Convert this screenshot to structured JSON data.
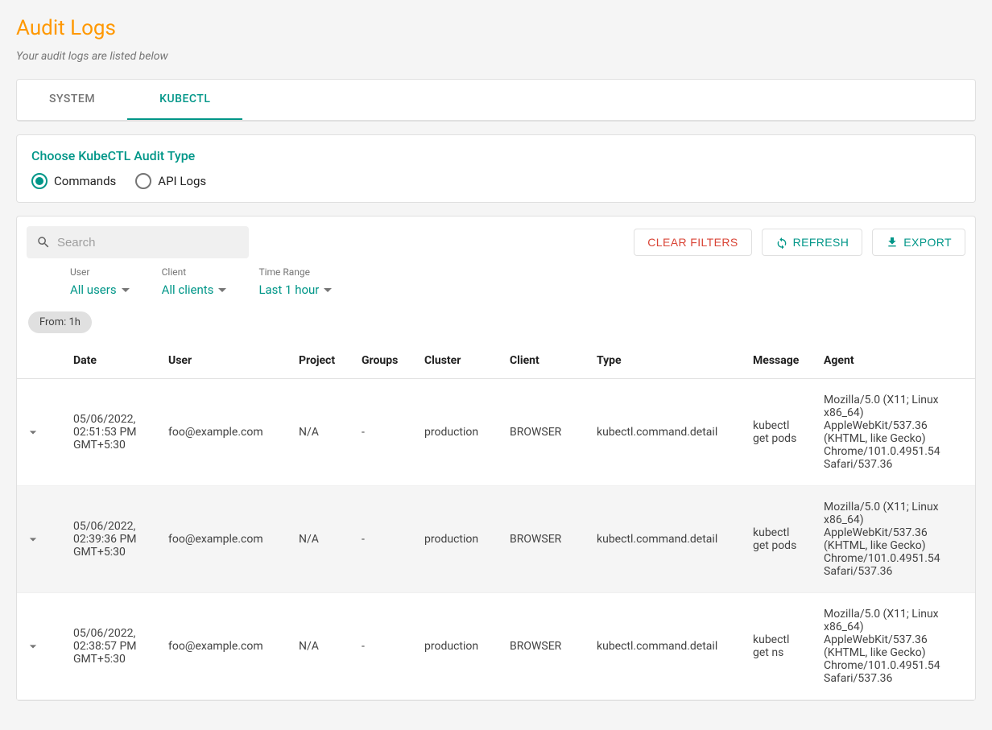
{
  "page": {
    "title": "Audit Logs",
    "subtitle": "Your audit logs are listed below"
  },
  "tabs": {
    "system": "SYSTEM",
    "kubectl": "KUBECTL"
  },
  "auditType": {
    "title": "Choose KubeCTL Audit Type",
    "commands_label": "Commands",
    "api_logs_label": "API Logs"
  },
  "search": {
    "placeholder": "Search",
    "value": ""
  },
  "actions": {
    "clear_filters": "CLEAR FILTERS",
    "refresh": "REFRESH",
    "export": "EXPORT"
  },
  "filters": {
    "user": {
      "label": "User",
      "value": "All users"
    },
    "client": {
      "label": "Client",
      "value": "All clients"
    },
    "time_range": {
      "label": "Time Range",
      "value": "Last 1 hour"
    }
  },
  "chip": "From: 1h",
  "columns": {
    "date": "Date",
    "user": "User",
    "project": "Project",
    "groups": "Groups",
    "cluster": "Cluster",
    "client": "Client",
    "type": "Type",
    "message": "Message",
    "agent": "Agent"
  },
  "rows": [
    {
      "date": "05/06/2022, 02:51:53 PM GMT+5:30",
      "user": "foo@example.com",
      "project": "N/A",
      "groups": "-",
      "cluster": "production",
      "client": "BROWSER",
      "type": "kubectl.command.detail",
      "message": "kubectl get pods",
      "agent": "Mozilla/5.0 (X11; Linux x86_64) AppleWebKit/537.36 (KHTML, like Gecko) Chrome/101.0.4951.54 Safari/537.36"
    },
    {
      "date": "05/06/2022, 02:39:36 PM GMT+5:30",
      "user": "foo@example.com",
      "project": "N/A",
      "groups": "-",
      "cluster": "production",
      "client": "BROWSER",
      "type": "kubectl.command.detail",
      "message": "kubectl get pods",
      "agent": "Mozilla/5.0 (X11; Linux x86_64) AppleWebKit/537.36 (KHTML, like Gecko) Chrome/101.0.4951.54 Safari/537.36"
    },
    {
      "date": "05/06/2022, 02:38:57 PM GMT+5:30",
      "user": "foo@example.com",
      "project": "N/A",
      "groups": "-",
      "cluster": "production",
      "client": "BROWSER",
      "type": "kubectl.command.detail",
      "message": "kubectl get ns",
      "agent": "Mozilla/5.0 (X11; Linux x86_64) AppleWebKit/537.36 (KHTML, like Gecko) Chrome/101.0.4951.54 Safari/537.36"
    }
  ]
}
